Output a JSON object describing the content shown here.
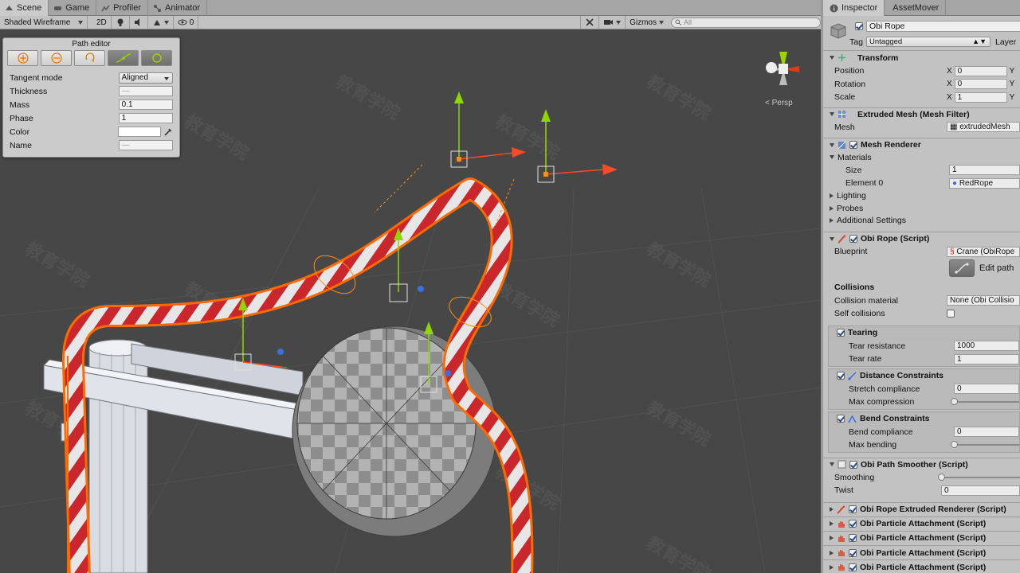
{
  "scene_tabs": [
    {
      "label": "Scene",
      "icon": "scene-icon",
      "active": true
    },
    {
      "label": "Game",
      "icon": "game-icon",
      "active": false
    },
    {
      "label": "Profiler",
      "icon": "profiler-icon",
      "active": false
    },
    {
      "label": "Animator",
      "icon": "animator-icon",
      "active": false
    }
  ],
  "scene_toolbar": {
    "draw_mode": "Shaded Wireframe",
    "mode_2d": "2D",
    "effects_count": "0",
    "gizmos": "Gizmos",
    "search_placeholder": "All"
  },
  "viewport": {
    "persp_label": "< Persp",
    "watermark": "教育学院"
  },
  "path_editor": {
    "title": "Path editor",
    "tools": [
      "add-point-icon",
      "remove-point-icon",
      "orient-icon",
      "tangent-mode-icon",
      "close-loop-icon"
    ],
    "tangent_mode_label": "Tangent mode",
    "tangent_mode_value": "Aligned",
    "thickness_label": "Thickness",
    "thickness_value": "—",
    "mass_label": "Mass",
    "mass_value": "0.1",
    "phase_label": "Phase",
    "phase_value": "1",
    "color_label": "Color",
    "color_value": "#ffffff",
    "name_label": "Name",
    "name_value": "—"
  },
  "inspector": {
    "tabs": [
      "Inspector",
      "AssetMover"
    ],
    "object_name": "Obi Rope",
    "tag_label": "Tag",
    "tag_value": "Untagged",
    "layer_label": "Layer",
    "transform": {
      "title": "Transform",
      "position_label": "Position",
      "position_x": "0",
      "rotation_label": "Rotation",
      "rotation_x": "0",
      "scale_label": "Scale",
      "scale_x": "1",
      "axis_x": "X",
      "axis_y": "Y"
    },
    "mesh_filter": {
      "title": "Extruded Mesh (Mesh Filter)",
      "mesh_label": "Mesh",
      "mesh_value": "extrudedMesh"
    },
    "mesh_renderer": {
      "title": "Mesh Renderer",
      "materials_label": "Materials",
      "size_label": "Size",
      "size_value": "1",
      "element0_label": "Element 0",
      "element0_value": "RedRope",
      "lighting_label": "Lighting",
      "probes_label": "Probes",
      "additional_label": "Additional Settings"
    },
    "obi_rope": {
      "title": "Obi Rope (Script)",
      "blueprint_label": "Blueprint",
      "blueprint_value": "Crane (ObiRope",
      "edit_path_label": "Edit path",
      "collisions_label": "Collisions",
      "collision_material_label": "Collision material",
      "collision_material_value": "None (Obi Collisio",
      "self_collisions_label": "Self collisions",
      "tearing_label": "Tearing",
      "tear_resistance_label": "Tear resistance",
      "tear_resistance_value": "1000",
      "tear_rate_label": "Tear rate",
      "tear_rate_value": "1",
      "distance_label": "Distance Constraints",
      "stretch_label": "Stretch compliance",
      "stretch_value": "0",
      "max_compression_label": "Max compression",
      "max_compression_value": 0,
      "bend_label": "Bend Constraints",
      "bend_compliance_label": "Bend compliance",
      "bend_compliance_value": "0",
      "max_bending_label": "Max bending",
      "max_bending_value": 0
    },
    "path_smoother": {
      "title": "Obi Path Smoother (Script)",
      "smoothing_label": "Smoothing",
      "smoothing_value": 0,
      "twist_label": "Twist",
      "twist_value": "0"
    },
    "extra_components": [
      "Obi Rope Extruded Renderer (Script)",
      "Obi Particle Attachment (Script)",
      "Obi Particle Attachment (Script)",
      "Obi Particle Attachment (Script)",
      "Obi Particle Attachment (Script)"
    ]
  }
}
